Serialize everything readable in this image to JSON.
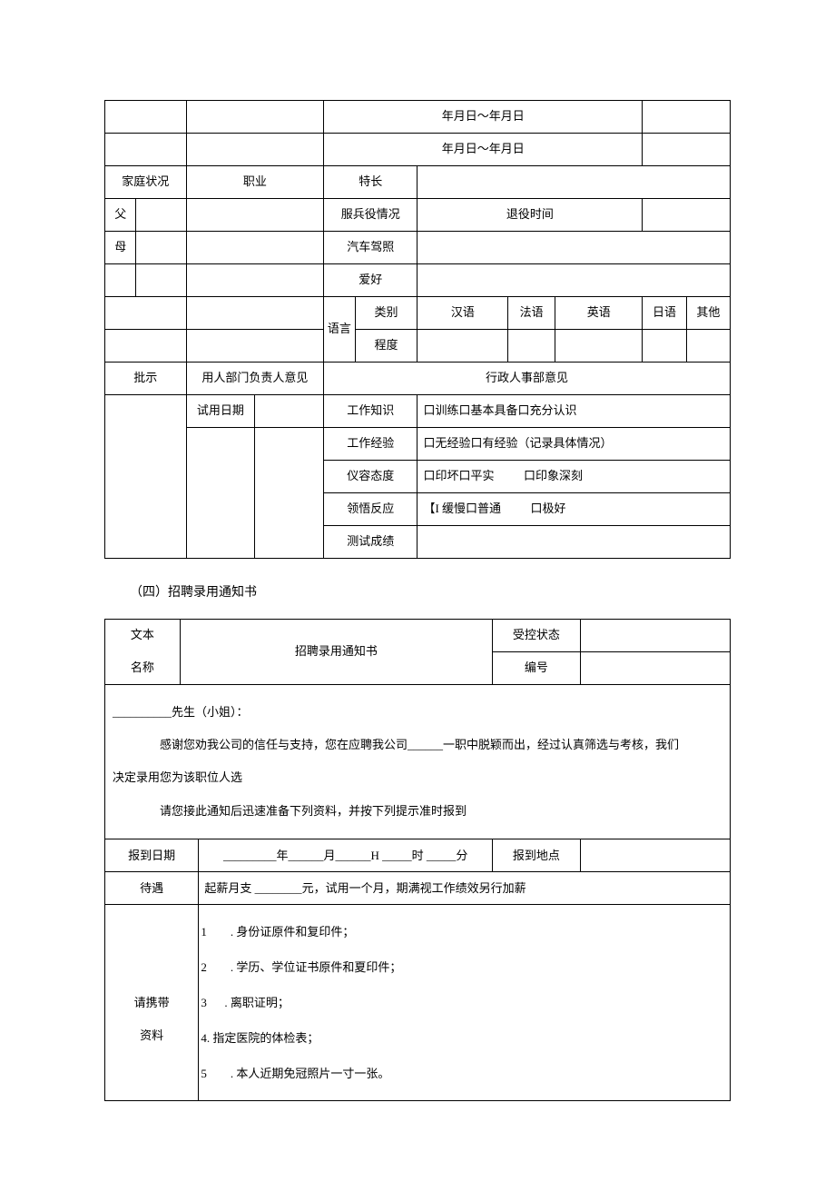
{
  "table1": {
    "date_range": "年月日～年月日",
    "family_status": "家庭状况",
    "occupation": "职业",
    "specialty": "特长",
    "father": "父",
    "military_service": "服兵役情况",
    "retire_time": "退役时间",
    "mother": "母",
    "driver_license": "汽车驾照",
    "hobby": "爱好",
    "language": "语言",
    "category": "类别",
    "chinese": "汉语",
    "french": "法语",
    "english": "英语",
    "japanese": "日语",
    "other": "其他",
    "degree": "程度",
    "instruction": "批示",
    "dept_opinion": "用人部门负责人意见",
    "hr_opinion": "行政人事部意见",
    "trial_period": "试用日期",
    "work_knowledge": "工作知识",
    "work_knowledge_opts": "口训练口基本具备口充分认识",
    "work_experience": "工作经验",
    "work_experience_opts": "口无经验口有经验（记录具体情况）",
    "appearance": "仪容态度",
    "appearance_opts_left": "口印坏口平实",
    "appearance_opts_right": "口印象深刻",
    "comprehension": "领悟反应",
    "comprehension_opts_left": "【I 缓慢口普通",
    "comprehension_opts_right": "口极好",
    "test_score": "测试成绩"
  },
  "section4_heading": "（四）招聘录用通知书",
  "table2": {
    "doc_name_label": "文本",
    "doc_name_label2": "名称",
    "doc_title": "招聘录用通知书",
    "control_status": "受控状态",
    "doc_number": "编号",
    "greeting": "__________先生（小姐）：",
    "body1": "感谢您劝我公司的信任与支持，您在应聘我公司______一职中脱颖而出，经过认真筛选与考核，我们",
    "body1b": "决定录用您为该职位人选",
    "body2": "请您接此通知后迅速准备下列资料，并按下列提示准时报到",
    "report_date_label": "报到日期",
    "report_date_value": "_________年______月______H _____时 _____分",
    "report_location_label": "报到地点",
    "treatment_label": "待遇",
    "treatment_value": "起薪月支 ________元，试用一个月，期满视工作绩效另行加薪",
    "materials_label1": "请携带",
    "materials_label2": "资料",
    "material1_num": "1",
    "material1_text": ". 身份证原件和复印件；",
    "material2_num": "2",
    "material2_text": ". 学历、学位证书原件和夏印件；",
    "material3_num": "3",
    "material3_text": ". 离职证明；",
    "material4": "4. 指定医院的体检表；",
    "material5_num": "5",
    "material5_text": ". 本人近期免冠照片一寸一张。"
  }
}
